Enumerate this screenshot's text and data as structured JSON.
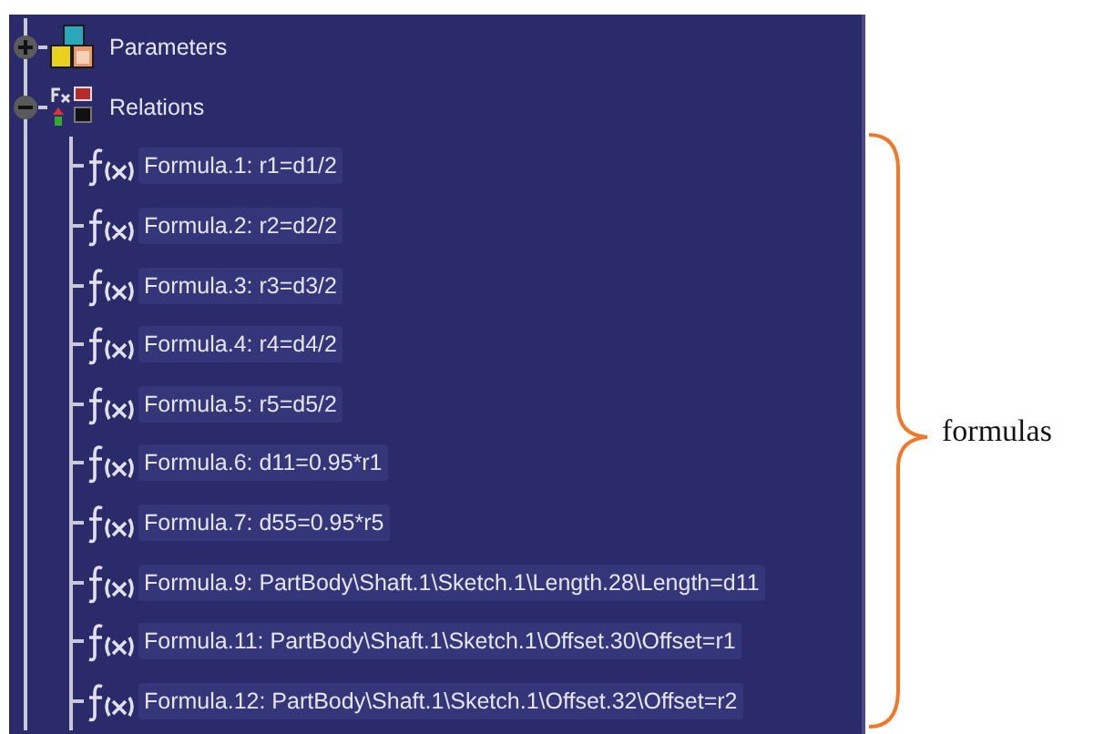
{
  "tree": [
    {
      "label": "Parameters",
      "kind": "parameters",
      "expanded": false
    },
    {
      "label": "Relations",
      "kind": "relations",
      "expanded": true,
      "children": [
        {
          "label": "Formula.1: r1=d1/2"
        },
        {
          "label": "Formula.2: r2=d2/2"
        },
        {
          "label": "Formula.3: r3=d3/2"
        },
        {
          "label": "Formula.4: r4=d4/2"
        },
        {
          "label": "Formula.5: r5=d5/2"
        },
        {
          "label": "Formula.6: d11=0.95*r1"
        },
        {
          "label": "Formula.7: d55=0.95*r5"
        },
        {
          "label": "Formula.9: PartBody\\Shaft.1\\Sketch.1\\Length.28\\Length=d11"
        },
        {
          "label": "Formula.11: PartBody\\Shaft.1\\Sketch.1\\Offset.30\\Offset=r1"
        },
        {
          "label": "Formula.12: PartBody\\Shaft.1\\Sketch.1\\Offset.32\\Offset=r2"
        }
      ]
    }
  ],
  "annotation": {
    "label": "formulas"
  }
}
